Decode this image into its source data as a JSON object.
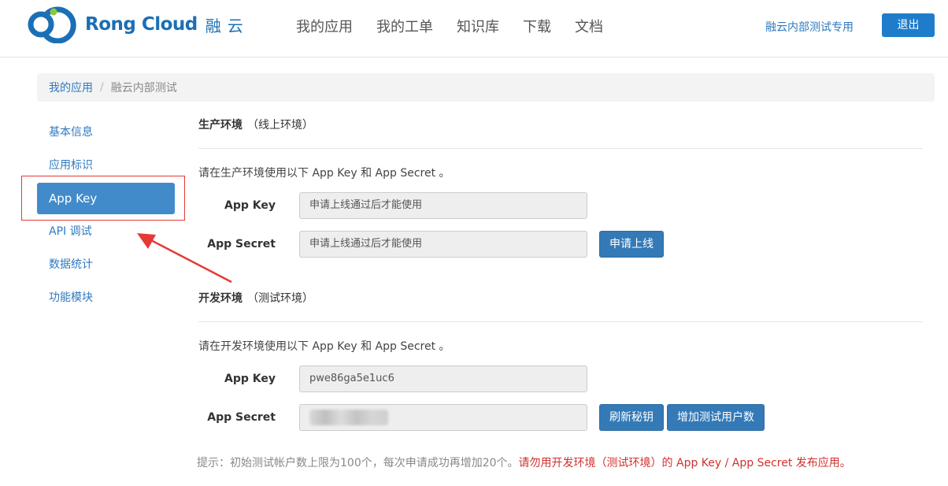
{
  "header": {
    "logo_en": "Rong Cloud",
    "logo_cn": "融云",
    "nav": [
      "我的应用",
      "我的工单",
      "知识库",
      "下载",
      "文档"
    ],
    "user_link": "融云内部测试专用",
    "logout_label": "退出"
  },
  "breadcrumb": {
    "home": "我的应用",
    "separator": "/",
    "current": "融云内部测试"
  },
  "sidebar": {
    "items": [
      {
        "label": "基本信息"
      },
      {
        "label": "应用标识"
      },
      {
        "label": "App Key"
      },
      {
        "label": "API 调试"
      },
      {
        "label": "数据统计"
      },
      {
        "label": "功能模块"
      }
    ],
    "active_index": 2
  },
  "production": {
    "title": "生产环境",
    "subtitle": "（线上环境）",
    "instruction": "请在生产环境使用以下 App Key 和 App Secret 。",
    "app_key_label": "App Key",
    "app_key_value": "申请上线通过后才能使用",
    "app_secret_label": "App Secret",
    "app_secret_value": "申请上线通过后才能使用",
    "apply_button": "申请上线"
  },
  "development": {
    "title": "开发环境",
    "subtitle": "（测试环境）",
    "instruction": "请在开发环境使用以下 App Key 和 App Secret 。",
    "app_key_label": "App Key",
    "app_key_value": "pwe86ga5e1uc6",
    "app_secret_label": "App Secret",
    "refresh_button": "刷新秘钥",
    "add_users_button": "增加测试用户数"
  },
  "note": {
    "text": "提示：初始测试帐户数上限为100个，每次申请成功再增加20个。",
    "warning": "请勿用开发环境（测试环境）的 App Key / App Secret 发布应用。"
  },
  "colors": {
    "brand": "#1b6fb5",
    "link": "#2f79c0",
    "active": "#428bca",
    "button": "#337ab7",
    "warning": "#d0312d",
    "annotation": "#e53935"
  }
}
